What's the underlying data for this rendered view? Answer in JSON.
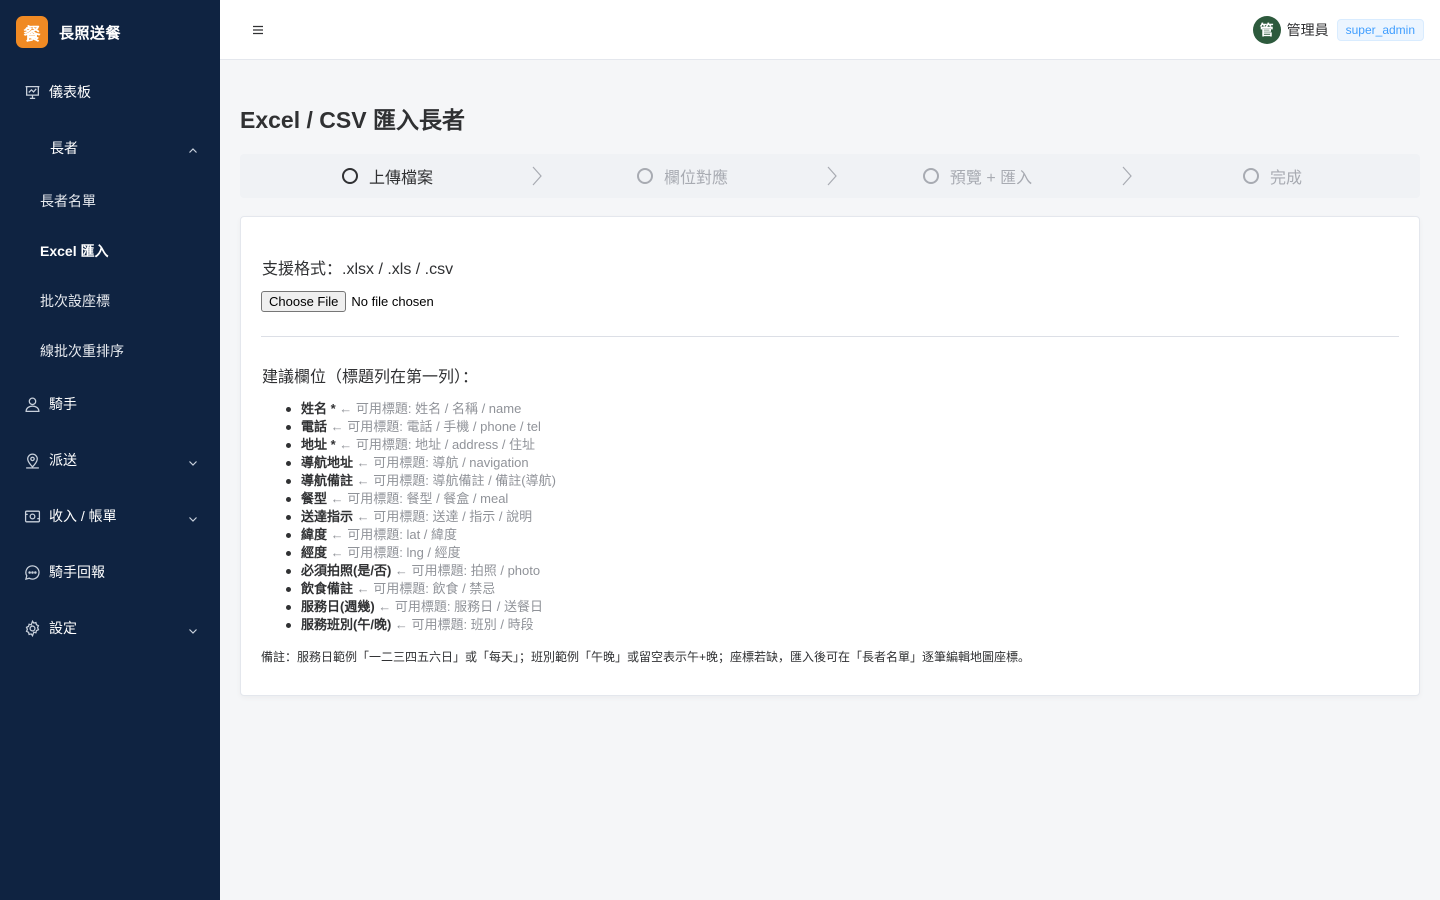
{
  "brand": {
    "logo_char": "餐",
    "name": "長照送餐"
  },
  "sidebar": {
    "dashboard": "儀表板",
    "elders_group": "長者",
    "elders_sub": [
      "長者名單",
      "Excel 匯入",
      "批次設座標",
      "線批次重排序"
    ],
    "riders": "騎手",
    "dispatch": "派送",
    "billing": "收入 / 帳單",
    "rider_reports": "騎手回報",
    "settings": "設定"
  },
  "header": {
    "avatar_char": "管",
    "user_name": "管理員",
    "role": "super_admin"
  },
  "page": {
    "title": "Excel / CSV 匯入長者"
  },
  "steps": [
    "上傳檔案",
    "欄位對應",
    "預覽 + 匯入",
    "完成"
  ],
  "upload": {
    "formats": "支援格式：.xlsx / .xls / .csv",
    "button": "Choose File",
    "status": "No file chosen"
  },
  "suggest_title": "建議欄位（標題列在第一列）：",
  "fields": [
    {
      "name": "姓名 *",
      "hint": " ← 可用標題: 姓名 / 名稱 / name"
    },
    {
      "name": "電話",
      "hint": " ← 可用標題: 電話 / 手機 / phone / tel"
    },
    {
      "name": "地址 *",
      "hint": " ← 可用標題: 地址 / address / 住址"
    },
    {
      "name": "導航地址",
      "hint": " ← 可用標題: 導航 / navigation"
    },
    {
      "name": "導航備註",
      "hint": " ← 可用標題: 導航備註 / 備註(導航)"
    },
    {
      "name": "餐型",
      "hint": " ← 可用標題: 餐型 / 餐盒 / meal"
    },
    {
      "name": "送達指示",
      "hint": " ← 可用標題: 送達 / 指示 / 說明"
    },
    {
      "name": "緯度",
      "hint": " ← 可用標題: lat / 緯度"
    },
    {
      "name": "經度",
      "hint": " ← 可用標題: lng / 經度"
    },
    {
      "name": "必須拍照(是/否)",
      "hint": " ← 可用標題: 拍照 / photo"
    },
    {
      "name": "飲食備註",
      "hint": " ← 可用標題: 飲食 / 禁忌"
    },
    {
      "name": "服務日(週幾)",
      "hint": " ← 可用標題: 服務日 / 送餐日"
    },
    {
      "name": "服務班別(午/晚)",
      "hint": " ← 可用標題: 班別 / 時段"
    }
  ],
  "note": "備註：服務日範例「一二三四五六日」或「每天」；班別範例「午晚」或留空表示午+晚；座標若缺，匯入後可在「長者名單」逐筆編輯地圖座標。"
}
